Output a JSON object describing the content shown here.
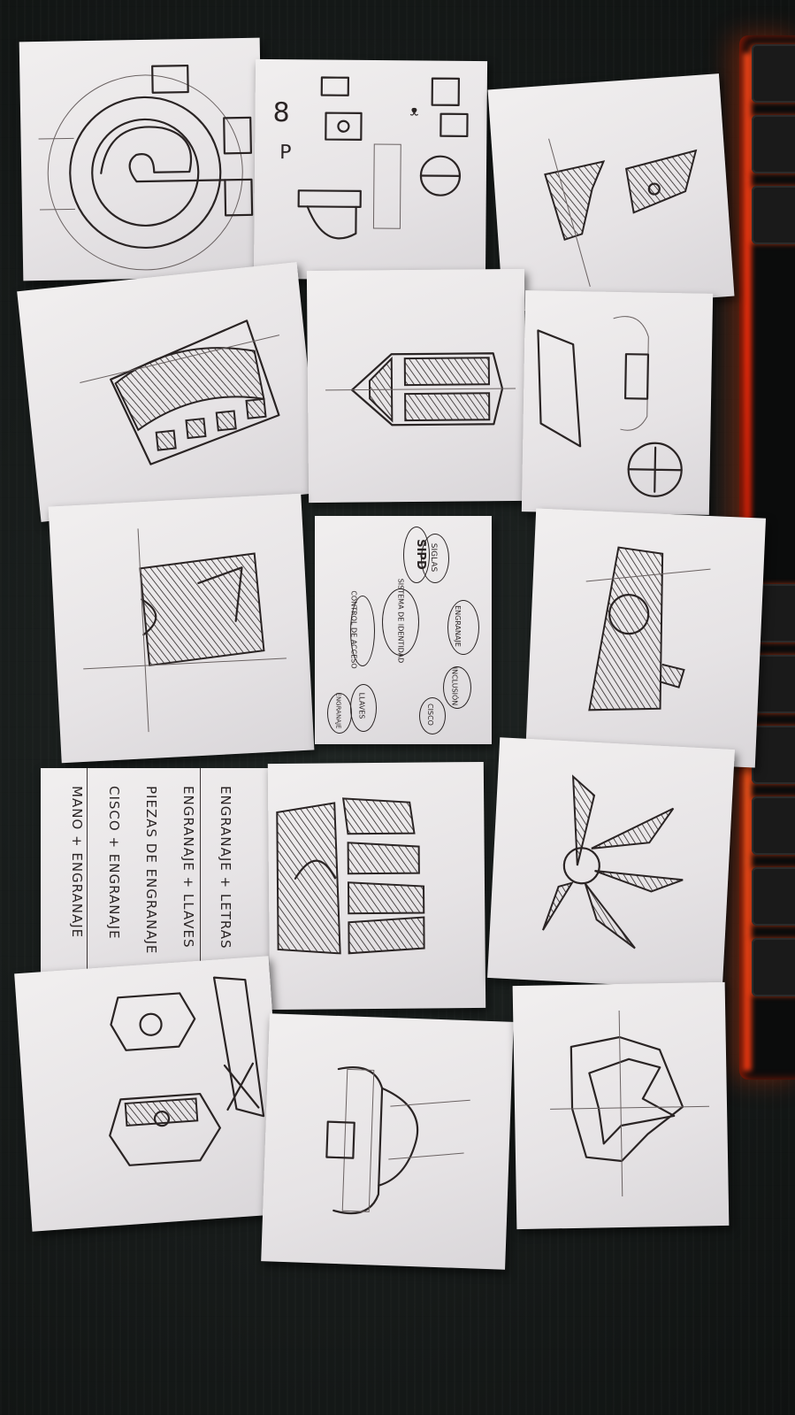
{
  "mindmap": {
    "center": "SISTEMA DE IDENTIDAD",
    "nodes": [
      "SIPD",
      "SIGLAS",
      "ENGRANAJE",
      "INCLUSIÓN",
      "CISCO",
      "LLAVES",
      "ENGRANAJE",
      "CONTROL DE ACCESO"
    ]
  },
  "list_note": {
    "lines": [
      "ENGRANAJE + LETRAS",
      "ENGRANAJE + LLAVES",
      "PIEZAS DE ENGRANAJE",
      "CISCO + ENGRANAJE",
      "MANO + ENGRANAJE"
    ]
  },
  "colors": {
    "desk": "#171b1a",
    "paper": "#ebe8ea",
    "ink": "#2a2424",
    "keyboard_glow": "#ff3a10"
  }
}
